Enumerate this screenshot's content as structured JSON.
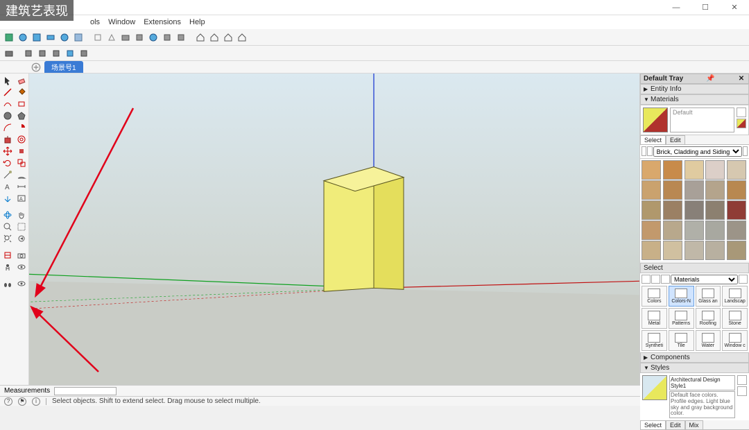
{
  "watermark": "建筑艺表现",
  "window": {
    "min": "—",
    "max": "☐",
    "close": "✕"
  },
  "menu": [
    "ols",
    "Window",
    "Extensions",
    "Help"
  ],
  "scene_tab": "场景号1",
  "tray": {
    "title": "Default Tray",
    "entity": "Entity Info",
    "materials": "Materials",
    "mat_default": "Default",
    "tab_select": "Select",
    "tab_edit": "Edit",
    "lib": "Brick, Cladding and Siding",
    "select_hdr": "Select",
    "sel_lib": "Materials",
    "comp_categories": [
      "Colors",
      "Colors-N",
      "Glass an",
      "Landscap",
      "Metal",
      "Patterns",
      "Roofing",
      "Stone",
      "Syntheti",
      "Tile",
      "Water",
      "Window c"
    ],
    "components": "Components",
    "styles": "Styles",
    "style_name": "Architectural Design Style1",
    "style_desc": "Default face colors. Profile edges. Light blue sky and gray background color.",
    "styles_tabs": [
      "Select",
      "Edit",
      "Mix"
    ]
  },
  "measure_label": "Measurements",
  "status": "Select objects. Shift to extend select. Drag mouse to select multiple.",
  "swatch_colors": [
    "#d9a86c",
    "#c88b4a",
    "#e0cba0",
    "#dccfc8",
    "#d6c8b0",
    "#caa26e",
    "#b98852",
    "#a8a098",
    "#b4a48c",
    "#b88850",
    "#b0986c",
    "#9b8064",
    "#888078",
    "#8c8070",
    "#8f3c36",
    "#c2996c",
    "#b8a88c",
    "#b0b0a8",
    "#a8a8a0",
    "#9c9488",
    "#c8b088",
    "#d0c0a0",
    "#c0b8a8",
    "#b8b0a0",
    "#a89878"
  ]
}
